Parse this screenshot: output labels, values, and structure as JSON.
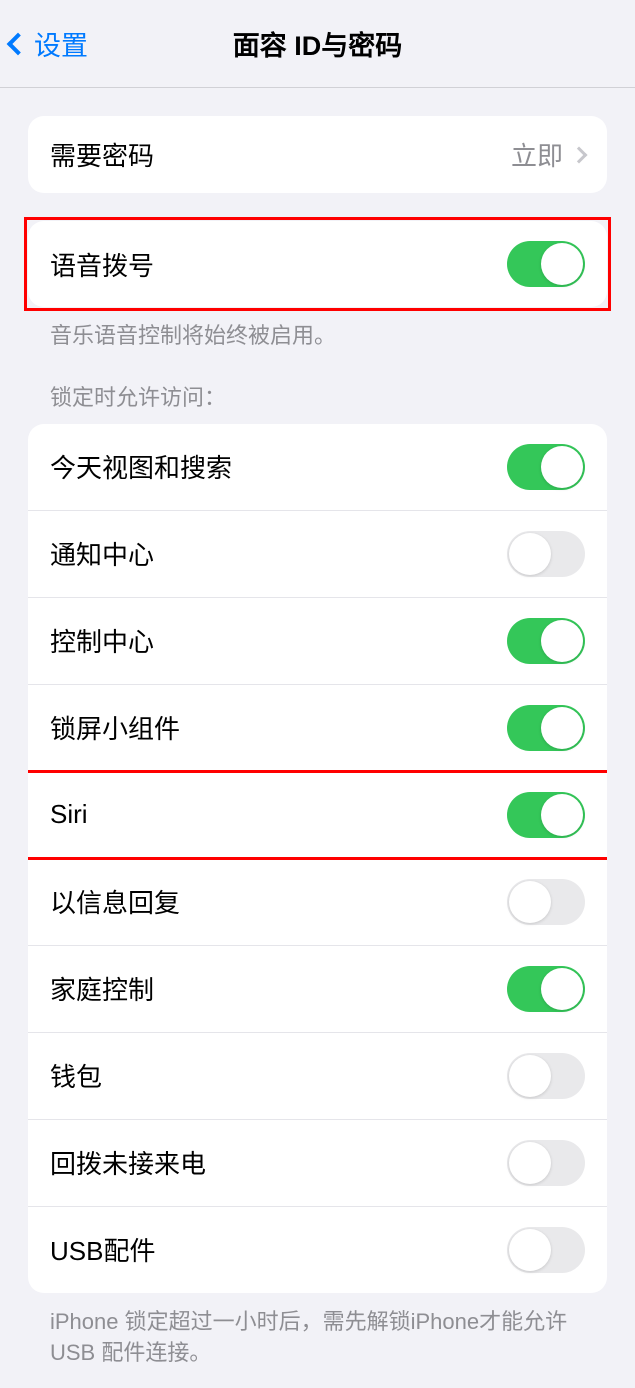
{
  "header": {
    "back_label": "设置",
    "title": "面容 ID与密码"
  },
  "passcode_section": {
    "require_passcode_label": "需要密码",
    "require_passcode_value": "立即"
  },
  "voice_dial_section": {
    "voice_dial_label": "语音拨号",
    "voice_dial_on": true,
    "footer": "音乐语音控制将始终被启用。"
  },
  "lock_access_section": {
    "header": "锁定时允许访问：",
    "items": [
      {
        "label": "今天视图和搜索",
        "on": true
      },
      {
        "label": "通知中心",
        "on": false
      },
      {
        "label": "控制中心",
        "on": true
      },
      {
        "label": "锁屏小组件",
        "on": true
      },
      {
        "label": "Siri",
        "on": true
      },
      {
        "label": "以信息回复",
        "on": false
      },
      {
        "label": "家庭控制",
        "on": true
      },
      {
        "label": "钱包",
        "on": false
      },
      {
        "label": "回拨未接来电",
        "on": false
      },
      {
        "label": "USB配件",
        "on": false
      }
    ],
    "footer": "iPhone 锁定超过一小时后，需先解锁iPhone才能允许USB 配件连接。"
  }
}
